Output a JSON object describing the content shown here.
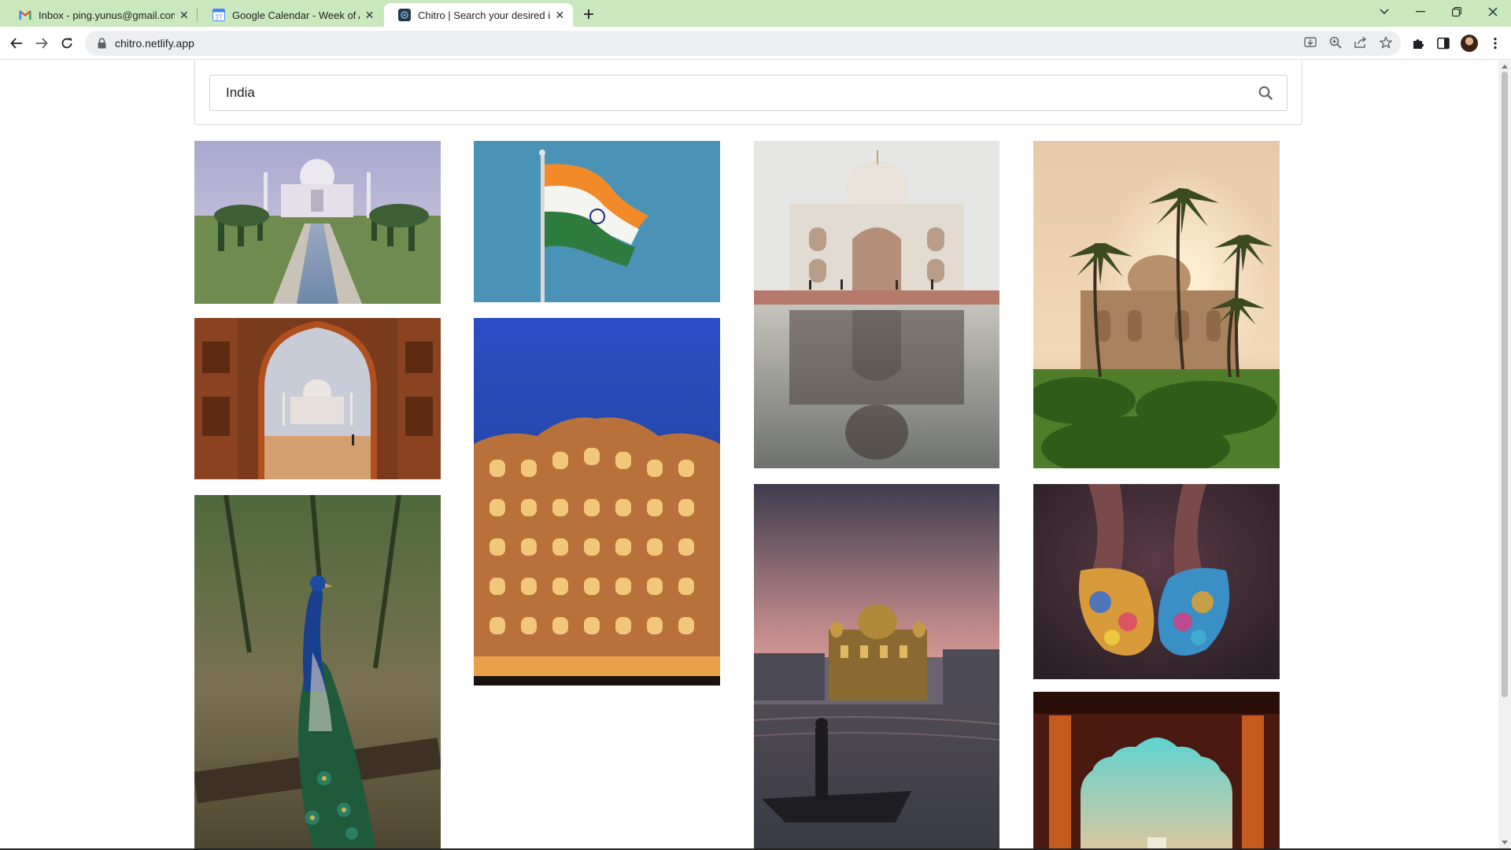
{
  "browser": {
    "tabs": [
      {
        "title": "Inbox - ping.yunus@gmail.com - Gmail",
        "favicon": "gmail-icon",
        "active": false
      },
      {
        "title": "Google Calendar - Week of August",
        "favicon": "calendar-icon",
        "favicon_text": "27",
        "active": false
      },
      {
        "title": "Chitro | Search your desired image",
        "favicon": "chitro-icon",
        "active": true
      }
    ],
    "address": "chitro.netlify.app",
    "colors": {
      "tabstrip": "#c9e8be",
      "omnibox": "#eceff1"
    }
  },
  "search": {
    "value": "India",
    "icon": "search-icon"
  },
  "gallery": {
    "images": [
      {
        "subject": "taj-mahal-reflecting-pool",
        "column": 1
      },
      {
        "subject": "taj-mahal-through-arch",
        "column": 1
      },
      {
        "subject": "peacock",
        "column": 1
      },
      {
        "subject": "indian-flag",
        "column": 2
      },
      {
        "subject": "hawa-mahal-night",
        "column": 2
      },
      {
        "subject": "taj-mahal-reflection",
        "column": 3
      },
      {
        "subject": "golden-temple-sunset",
        "column": 3
      },
      {
        "subject": "humayun-tomb-palms",
        "column": 4
      },
      {
        "subject": "holi-color-hands",
        "column": 4
      },
      {
        "subject": "arched-window-view",
        "column": 4
      }
    ]
  }
}
